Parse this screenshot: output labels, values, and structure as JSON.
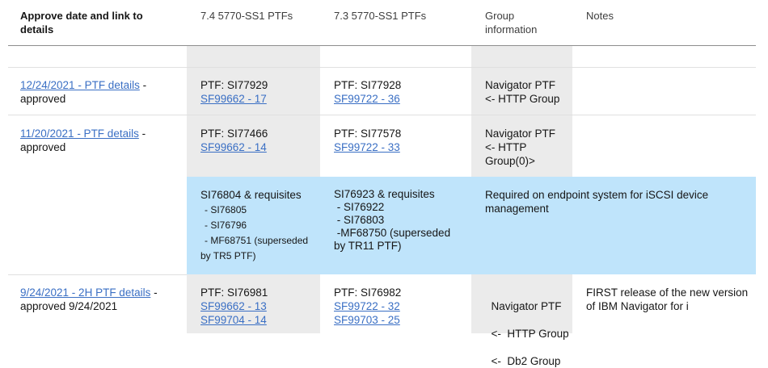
{
  "headers": {
    "col1": "Approve date and link to details",
    "col2": "7.4 5770-SS1 PTFs",
    "col3": "7.3 5770-SS1 PTFs",
    "col4": "Group information",
    "col5": "Notes"
  },
  "rows": [
    {
      "date_link": "12/24/2021 -  PTF details",
      "date_suffix": " -",
      "status": "approved",
      "ptf74": "PTF: SI77929",
      "ptf74_link1": "SF99662 - 17",
      "ptf73": "PTF: SI77928",
      "ptf73_link1": "SF99722 - 36",
      "group_line1": "Navigator PTF",
      "group_line2": "<- HTTP Group"
    },
    {
      "date_link": "11/20/2021 -  PTF details",
      "date_suffix": " -",
      "status": "approved",
      "ptf74": "PTF: SI77466",
      "ptf74_link1": "SF99662 - 14",
      "ptf73": "PTF: SI77578",
      "ptf73_link1": "SF99722 - 33",
      "group_line1": "Navigator PTF",
      "group_line2": "<- HTTP",
      "group_line3": "Group(0)>"
    },
    {
      "ptf74_title": "SI76804 & requisites",
      "ptf74_req1": "- SI76805",
      "ptf74_req2": "- SI76796",
      "ptf74_req3": "- MF68751 (superseded",
      "ptf74_req4": "by TR5 PTF)",
      "ptf73_title": "SI76923 & requisites",
      "ptf73_req1": " - SI76922",
      "ptf73_req2": " - SI76803",
      "ptf73_req3": " -MF68750 (superseded",
      "ptf73_req4": "by TR11 PTF)",
      "group_line1": "Required on endpoint system for iSCSI device",
      "group_line2": "management"
    },
    {
      "date_link": "9/24/2021 - 2H PTF details",
      "date_suffix": " -",
      "status": "approved 9/24/2021",
      "ptf74": "PTF: SI76981",
      "ptf74_link1": "SF99662 - 13",
      "ptf74_link2": "SF99704 - 14",
      "ptf73": "PTF: SI76982",
      "ptf73_link1": "SF99722 - 32",
      "ptf73_link2": "SF99703 - 25",
      "group_line1": "Navigator PTF",
      "group_line2": "<-  HTTP Group",
      "group_line3": "<-  Db2 Group",
      "notes_line1": "FIRST release of the new version",
      "notes_line2": "of IBM Navigator for i"
    }
  ],
  "colors": {
    "shade": "#ebebeb",
    "highlight": "#bfe4fb",
    "link": "#3a6fc4"
  }
}
